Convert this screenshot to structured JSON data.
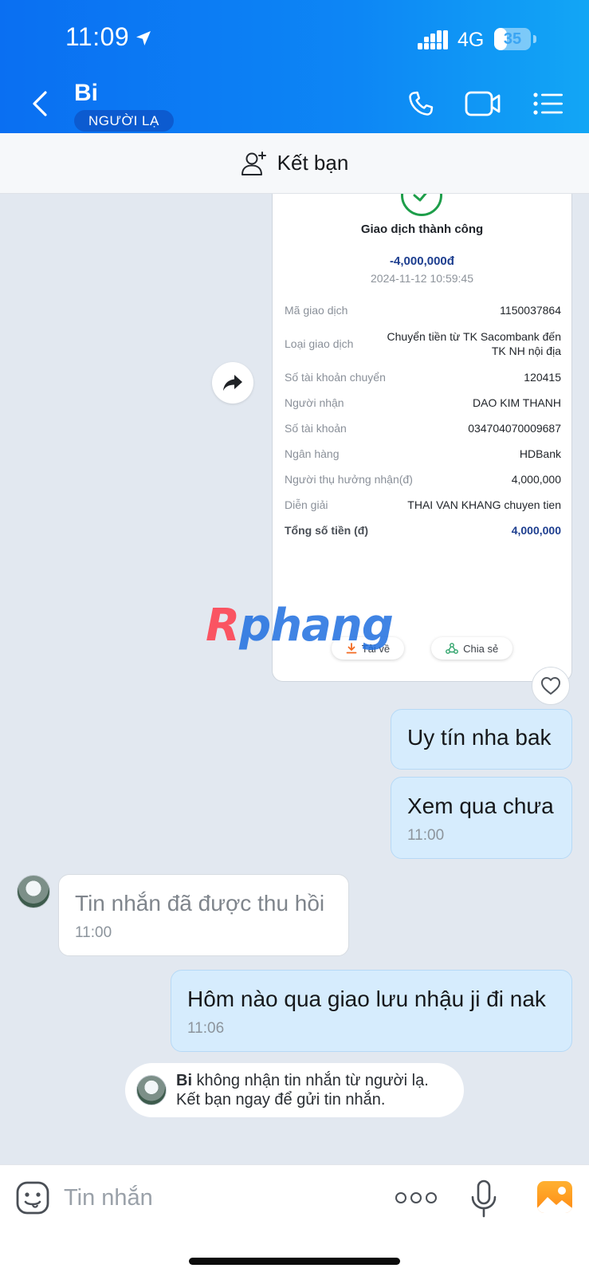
{
  "status_bar": {
    "time": "11:09",
    "network": "4G",
    "battery": "35",
    "battery_level": 0.35
  },
  "header": {
    "contact_name": "Bi",
    "badge": "NGƯỜI LẠ",
    "icons": [
      "back-icon",
      "phone-icon",
      "video-call-icon",
      "menu-list-icon"
    ]
  },
  "add_friend": {
    "label": "Kết bạn"
  },
  "receipt": {
    "title": "Giao dịch thành công",
    "amount": "-4,000,000đ",
    "datetime": "2024-11-12 10:59:45",
    "rows": [
      {
        "label": "Mã giao dịch",
        "value": "1150037864"
      },
      {
        "label": "Loại giao dịch",
        "value": "Chuyển tiền từ TK Sacombank đến TK NH nội địa"
      },
      {
        "label": "Số tài khoản chuyển",
        "value": "120415"
      },
      {
        "label": "Người nhận",
        "value": "DAO KIM THANH"
      },
      {
        "label": "Số tài khoản",
        "value": "034704070009687"
      },
      {
        "label": "Ngân hàng",
        "value": "HDBank"
      },
      {
        "label": "Người thụ hưởng nhận(đ)",
        "value": "4,000,000"
      },
      {
        "label": "Diễn giải",
        "value": "THAI VAN KHANG chuyen tien"
      },
      {
        "label": "Tổng số tiền (đ)",
        "value": "4,000,000"
      }
    ],
    "download_label": "Tải về",
    "share_label": "Chia sẻ"
  },
  "watermark": {
    "first": "R",
    "rest": "phang"
  },
  "messages": [
    {
      "direction": "out",
      "text": "Uy tín nha bak"
    },
    {
      "direction": "out",
      "text": "Xem qua chưa",
      "time": "11:00"
    },
    {
      "direction": "in",
      "text": "Tin nhắn đã được thu hồi",
      "time": "11:00"
    },
    {
      "direction": "out",
      "text": "Hôm nào qua giao lưu nhậu ji đi nak",
      "time": "11:06"
    }
  ],
  "notice": {
    "name": "Bi",
    "text": " không nhận tin nhắn từ người lạ.",
    "text2": "Kết bạn ngay để gửi tin nhắn."
  },
  "input": {
    "placeholder": "Tin nhắn",
    "value": ""
  }
}
